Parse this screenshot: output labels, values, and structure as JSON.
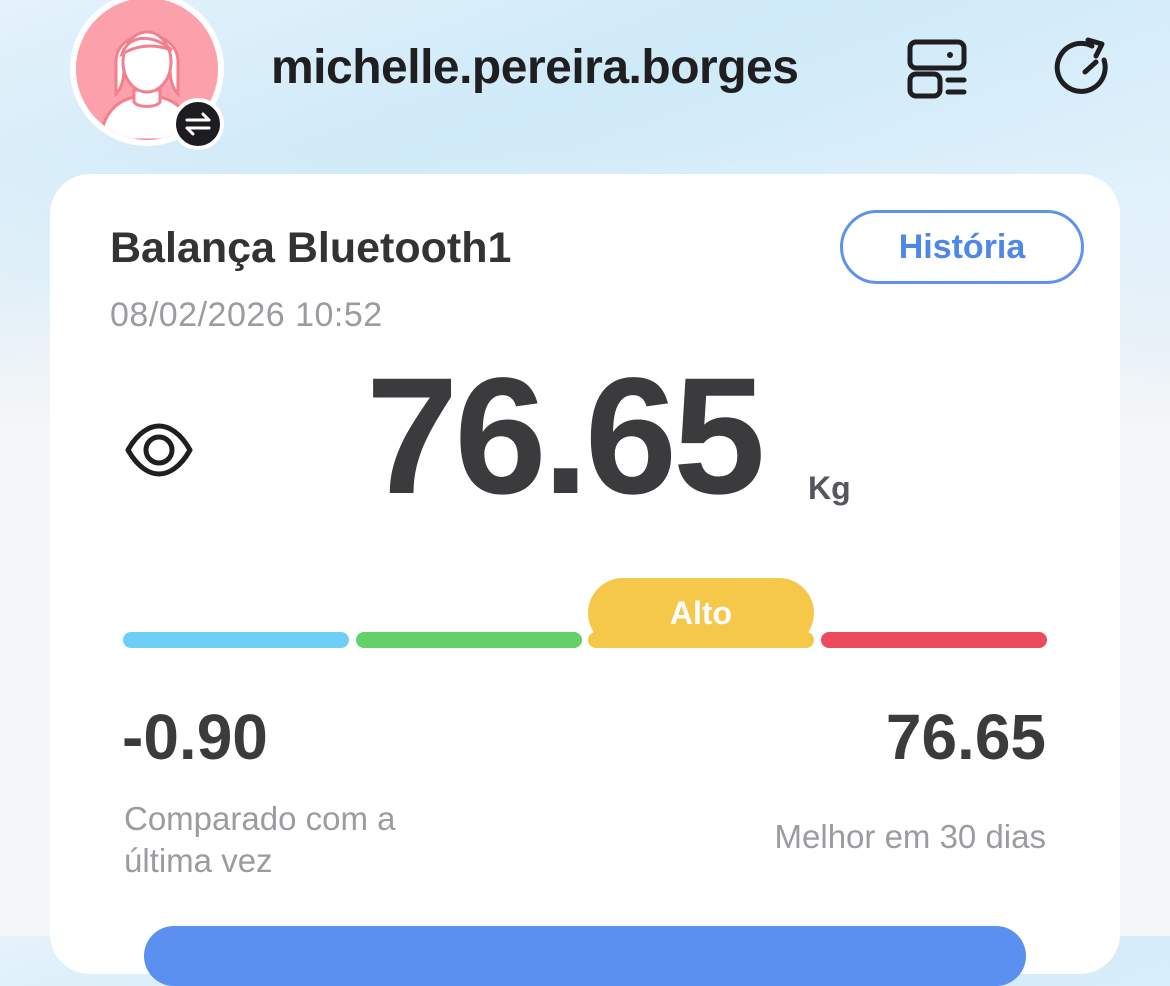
{
  "header": {
    "username": "michelle.pereira.borges",
    "avatar_icon": "avatar-female-icon",
    "switch_icon": "switch-user-icon",
    "devices_icon": "devices-icon",
    "sync_icon": "sync-icon"
  },
  "card": {
    "device_name": "Balança Bluetooth1",
    "timestamp": "08/02/2026 10:52",
    "history_label": "História",
    "weight": "76.65",
    "unit": "Kg",
    "range": {
      "label": "Alto",
      "segments": [
        "#6dcff6",
        "#65cf6a",
        "#f6c84a",
        "#ec4b5f"
      ],
      "active_index": 2
    },
    "diff_value": "-0.90",
    "diff_label": "Comparado com a última vez",
    "best_value": "76.65",
    "best_label": "Melhor em 30 dias"
  },
  "colors": {
    "accent": "#5b8ff0",
    "badge": "#f6c84a",
    "text": "#3b3b3e",
    "muted": "#9a9ca0"
  }
}
